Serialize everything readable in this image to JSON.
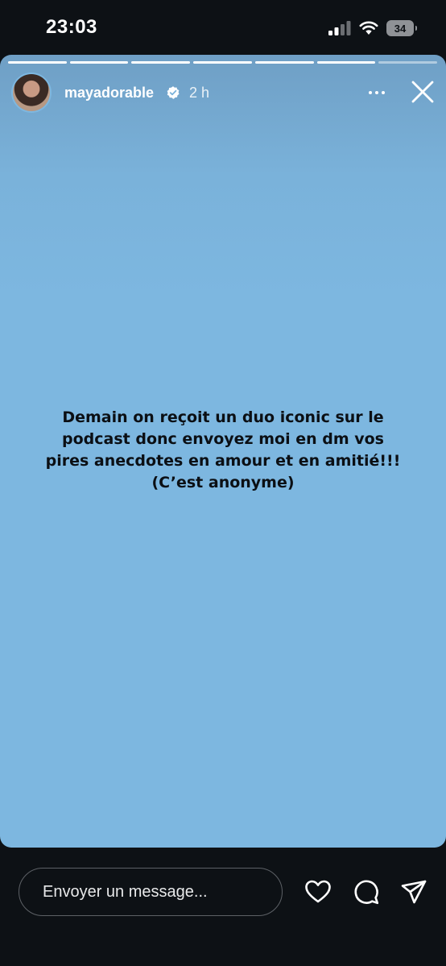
{
  "status_bar": {
    "time": "23:03",
    "battery": "34"
  },
  "story": {
    "username": "mayadorable",
    "time_ago": "2 h",
    "verified": true,
    "segment_count": 7,
    "current_segment": 7,
    "current_segment_progress": 0,
    "text": "Demain on reçoit un duo iconic sur le\npodcast donc envoyez moi en dm vos\npires anecdotes en amour et en amitié!!!\n(C’est anonyme)",
    "background_color": "#7db7e0",
    "text_color": "#0b0f14"
  },
  "reply_bar": {
    "placeholder": "Envoyer un message..."
  },
  "icons": {
    "verified": "verified-badge-icon",
    "more": "more-options-icon",
    "close": "close-icon",
    "like": "heart-icon",
    "comment": "comment-icon",
    "share": "send-icon"
  }
}
